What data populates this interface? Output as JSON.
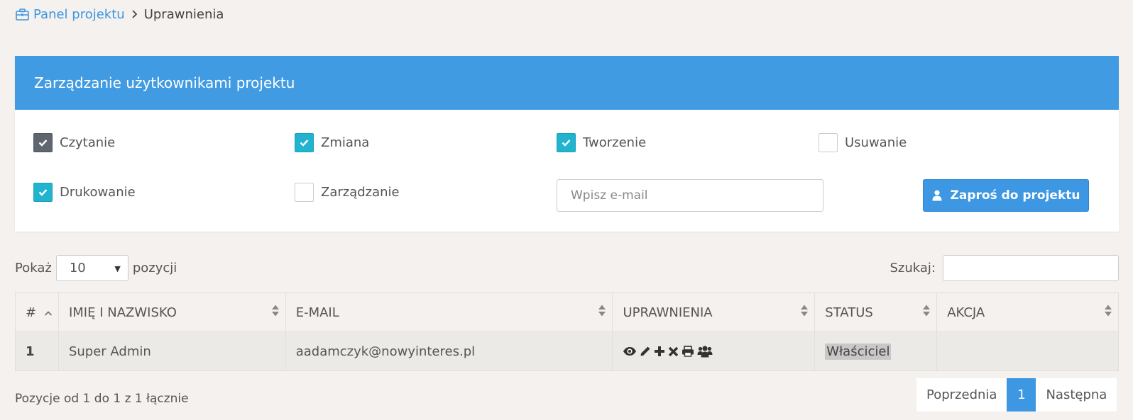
{
  "breadcrumb": {
    "parent": "Panel projektu",
    "current": "Uprawnienia"
  },
  "panel": {
    "title": "Zarządzanie użytkownikami projektu",
    "permissions": [
      {
        "label": "Czytanie",
        "checked": true,
        "style": "dark"
      },
      {
        "label": "Zmiana",
        "checked": true,
        "style": "teal"
      },
      {
        "label": "Tworzenie",
        "checked": true,
        "style": "teal"
      },
      {
        "label": "Usuwanie",
        "checked": false
      },
      {
        "label": "Drukowanie",
        "checked": true,
        "style": "teal"
      },
      {
        "label": "Zarządzanie",
        "checked": false
      }
    ],
    "email_placeholder": "Wpisz e-mail",
    "invite_label": "Zaproś do projektu"
  },
  "table_controls": {
    "show_label": "Pokaż",
    "page_size": "10",
    "items_label": "pozycji",
    "search_label": "Szukaj:"
  },
  "table": {
    "headers": [
      "#",
      "Imię i nazwisko",
      "E-mail",
      "Uprawnienia",
      "Status",
      "Akcja"
    ],
    "rows": [
      {
        "num": "1",
        "name": "Super Admin",
        "email": "aadamczyk@nowyinteres.pl",
        "permission_icons": [
          "eye-icon",
          "pencil-icon",
          "plus-icon",
          "times-icon",
          "print-icon",
          "users-icon"
        ],
        "status": "Właściciel",
        "action": ""
      }
    ]
  },
  "footer": {
    "info": "Pozycje od 1 do 1 z 1 łącznie",
    "prev": "Poprzednia",
    "current_page": "1",
    "next": "Następna"
  },
  "colors": {
    "accent": "#419be3",
    "teal": "#22b3cf",
    "background": "#f4f1ee"
  }
}
